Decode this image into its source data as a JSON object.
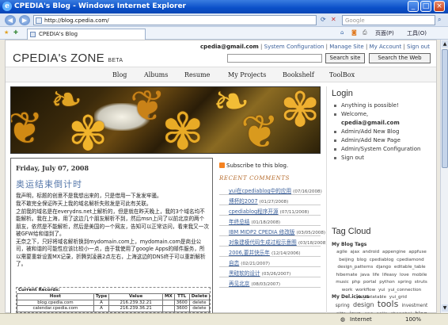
{
  "window": {
    "title": "CPEDIA's Blog - Windows Internet Explorer"
  },
  "address": {
    "url": "http://blog.cpedia.com/",
    "search_placeholder": "Google"
  },
  "tab": {
    "label": "CPEDIA's Blog"
  },
  "commands": {
    "page": "页面(P)",
    "tools": "工具(O)"
  },
  "site": {
    "user_email": "cpedia@gmail.com",
    "top_links": [
      "System Configuration",
      "Manage Site",
      "My Account",
      "Sign out"
    ],
    "logo": "CPEDIA's ZONE",
    "logo_suffix": "BETA",
    "search_site": "Search site",
    "search_web": "Search the Web",
    "menu": [
      "Blog",
      "Albums",
      "Resume",
      "My Projects",
      "Bookshelf",
      "ToolBox"
    ]
  },
  "post": {
    "date": "Friday, July 07, 2008",
    "title": "奥运结束倒计时",
    "paragraphs": [
      "我声明，标题的创意不是我想出来的，只是借用一下发发牢骚。",
      "我不敢完全保证昨天上我的域名解析失败发是可此有关联。",
      "之前我的域名是在everydns.net上解析的，但是就在昨天晚上，我的3个域名均不能解析。我在上海，用了这边几个朋友解析不到，然后msn上问了以前北京的两个朋友，依然是不能解析，然后是美国的一个网友，告知可以正常访问，看来我又一次被GFW给和谐到了。",
      "无奈之下，只好将域名解析换到mydomain.com上，mydomain.com是商业公司，被和谐的可能性应该比较小一点，由于我使用了google Apps的邮件服务，所以需要重新设置MX记录，折腾到凌晨2点左右，上海这边的DNS终于可以重新解析了。"
    ],
    "dns_caption": "Current Records:",
    "dns_headers": [
      "Host",
      "Type",
      "Value",
      "MX",
      "TTL",
      "Delete"
    ],
    "dns_rows": [
      [
        "blog.cpedia.com",
        "A",
        "216.239.32.21",
        "",
        "3600",
        "delete"
      ],
      [
        "calendar.cpedia.com",
        "A",
        "216.239.36.21",
        "",
        "3600",
        "delete"
      ]
    ]
  },
  "middle": {
    "subscribe": "Subscribe to this blog.",
    "recent_heading": "RECENT COMMENTS",
    "comments": [
      {
        "title": "yui在cpediablog中的应用",
        "date": "(07/16/2008)"
      },
      {
        "title": "博杯的2007",
        "date": "(01/27/2008)"
      },
      {
        "title": "cpediablog程序开源",
        "date": "(07/11/2008)"
      },
      {
        "title": "年终总结",
        "date": "(01/18/2008)"
      },
      {
        "title": "IBM MIDP2 CPEDIA 修改版",
        "date": "(03/05/2008)"
      },
      {
        "title": "对象建模代码生成过程示意图",
        "date": "(03/18/2008)"
      },
      {
        "title": "2006,要并快乐年",
        "date": "(12/14/2006)"
      },
      {
        "title": "自恋",
        "date": "(02/21/2007)"
      },
      {
        "title": "黑硅软的设计",
        "date": "(03/26/2007)"
      },
      {
        "title": "再见北京",
        "date": "(08/03/2007)"
      }
    ]
  },
  "sidebar": {
    "login_heading": "Login",
    "login_items": [
      "Anything is possible!",
      "Welcome,",
      "Admin/Add New Blog",
      "Admin/Add New Page",
      "Admin/System Configuration",
      "Sign out"
    ],
    "welcome_user": "cpedia@gmail.com",
    "tag_heading": "Tag Cloud",
    "blog_tags_label": "My Blog Tags",
    "blog_tags": [
      "agile",
      "ajax",
      "android",
      "appengine",
      "appfuse",
      "beijing",
      "blog",
      "cpediablog",
      "cpediamond",
      "design_patterns",
      "django",
      "editable_table",
      "hibernate",
      "java",
      "life",
      "lifeasy",
      "love",
      "mobile",
      "music",
      "php",
      "portal",
      "python",
      "spring",
      "struts",
      "work",
      "workflow",
      "yui",
      "yui_connection",
      "yui_datatable",
      "yui_grid"
    ],
    "delicious_label": "My Del.icio.us",
    "delicious_tags": [
      "spring",
      "design",
      "tools",
      "investment",
      "gilta",
      "java",
      "eng",
      "agile",
      "shanghai",
      "blog",
      "webware",
      "music",
      "opensource",
      "crack",
      "android"
    ]
  },
  "status": {
    "zone": "Internet",
    "zoom": "100%"
  }
}
